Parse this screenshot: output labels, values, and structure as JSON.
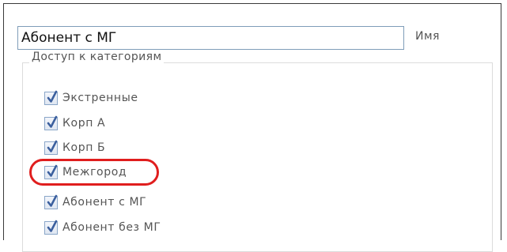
{
  "name_field": {
    "value": "Абонент с МГ",
    "label": "Имя"
  },
  "categories": {
    "legend": "Доступ к категориям",
    "items": [
      {
        "label": "Экстренные",
        "checked": true
      },
      {
        "label": "Корп А",
        "checked": true
      },
      {
        "label": "Корп Б",
        "checked": true
      },
      {
        "label": "Межгород",
        "checked": true,
        "highlighted": true
      },
      {
        "label": "Абонент с МГ",
        "checked": true
      },
      {
        "label": "Абонент без МГ",
        "checked": true
      }
    ]
  },
  "colors": {
    "highlight": "#e01e1e",
    "checkmark": "#3b5f9e"
  }
}
